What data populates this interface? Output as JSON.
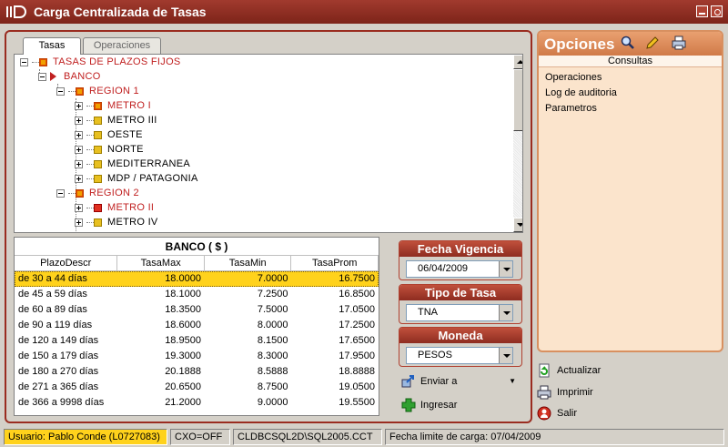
{
  "window": {
    "title": "Carga Centralizada de Tasas"
  },
  "tabs": [
    {
      "label": "Tasas"
    },
    {
      "label": "Operaciones"
    }
  ],
  "tree": {
    "root": "TASAS DE PLAZOS FIJOS",
    "banco": "BANCO",
    "region1": "REGION 1",
    "region1_items": [
      "METRO I",
      "METRO III",
      "OESTE",
      "NORTE",
      "MEDITERRANEA",
      "MDP / PATAGONIA"
    ],
    "region2": "REGION 2",
    "region2_items": [
      "METRO II",
      "METRO IV"
    ]
  },
  "grid": {
    "title": "BANCO ( $ )",
    "columns": [
      "PlazoDescr",
      "TasaMax",
      "TasaMin",
      "TasaProm"
    ],
    "rows": [
      [
        "de 30 a 44 días",
        "18.0000",
        "7.0000",
        "16.7500"
      ],
      [
        "de 45 a 59 días",
        "18.1000",
        "7.2500",
        "16.8500"
      ],
      [
        "de 60 a 89 días",
        "18.3500",
        "7.5000",
        "17.0500"
      ],
      [
        "de 90 a 119 días",
        "18.6000",
        "8.0000",
        "17.2500"
      ],
      [
        "de 120 a 149 días",
        "18.9500",
        "8.1500",
        "17.6500"
      ],
      [
        "de 150 a 179 días",
        "19.3000",
        "8.3000",
        "17.9500"
      ],
      [
        "de 180 a 270 días",
        "20.1888",
        "8.5888",
        "18.8888"
      ],
      [
        "de 271 a 365 días",
        "20.6500",
        "8.7500",
        "19.0500"
      ],
      [
        "de 366 a 9998 días",
        "21.2000",
        "9.0000",
        "19.5500"
      ]
    ]
  },
  "filters": {
    "fecha": {
      "label": "Fecha Vigencia",
      "value": "06/04/2009"
    },
    "tipo": {
      "label": "Tipo de Tasa",
      "value": "TNA"
    },
    "moneda": {
      "label": "Moneda",
      "value": "PESOS"
    }
  },
  "actions": {
    "enviar": "Enviar a",
    "ingresar": "Ingresar"
  },
  "opciones": {
    "title": "Opciones",
    "subtitle": "Consultas",
    "items": [
      "Operaciones",
      "Log de auditoria",
      "Parametros"
    ]
  },
  "side_actions": {
    "actualizar": "Actualizar",
    "imprimir": "Imprimir",
    "salir": "Salir"
  },
  "status": {
    "user": "Usuario: Pablo Conde (L0727083)",
    "cxo": "CXO=OFF",
    "server": "CLDBCSQL2D\\SQL2005.CCT",
    "fecha_limite": "Fecha limite de carga: 07/04/2009"
  },
  "colors": {
    "accent": "#9a2c20",
    "selected_row": "#ffd21c",
    "opciones_bg": "#fbe4cc"
  }
}
